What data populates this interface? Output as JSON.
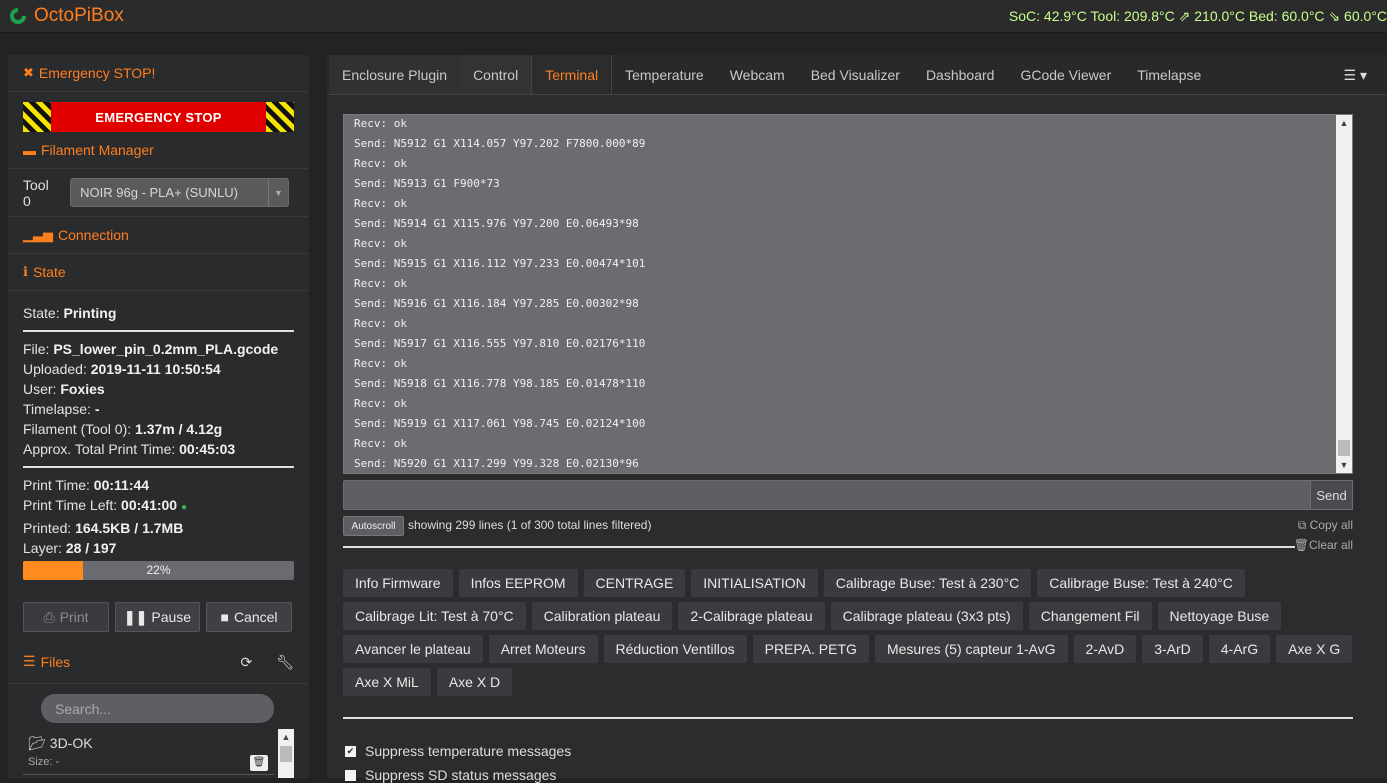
{
  "app": {
    "name": "OctoPiBox",
    "accent": "#ff7f1f"
  },
  "status_bar": {
    "text": "SoC: 42.9°C Tool: 209.8°C ⇗ 210.0°C Bed: 60.0°C ⇘ 60.0°C"
  },
  "sidebar": {
    "emergency_title": "Emergency STOP!",
    "emergency_button": "EMERGENCY STOP",
    "filament_title": "Filament Manager",
    "tool_label": "Tool 0",
    "tool_selected": "NOIR 96g - PLA+ (SUNLU)",
    "connection_title": "Connection",
    "state_title": "State",
    "state": {
      "state_label": "State:",
      "state_value": "Printing",
      "file_label": "File:",
      "file_value": "PS_lower_pin_0.2mm_PLA.gcode",
      "uploaded_label": "Uploaded:",
      "uploaded_value": "2019-11-11 10:50:54",
      "user_label": "User:",
      "user_value": "Foxies",
      "timelapse_label": "Timelapse:",
      "timelapse_value": "-",
      "filament_label": "Filament (Tool 0):",
      "filament_value": "1.37m / 4.12g",
      "approx_label": "Approx. Total Print Time:",
      "approx_value": "00:45:03",
      "print_time_label": "Print Time:",
      "print_time_value": "00:11:44",
      "time_left_label": "Print Time Left:",
      "time_left_value": "00:41:00",
      "printed_label": "Printed:",
      "printed_value": "164.5KB / 1.7MB",
      "layer_label": "Layer:",
      "layer_value": "28 / 197",
      "progress_text": "22%",
      "progress_fraction": 0.22
    },
    "buttons": {
      "print": "Print",
      "pause": "Pause",
      "cancel": "Cancel"
    },
    "files_title": "Files",
    "search_placeholder": "Search...",
    "files": [
      {
        "name": "3D-OK",
        "size": "Size: -"
      }
    ]
  },
  "tabs": [
    "Enclosure Plugin",
    "Control",
    "Terminal",
    "Temperature",
    "Webcam",
    "Bed Visualizer",
    "Dashboard",
    "GCode Viewer",
    "Timelapse"
  ],
  "terminal": {
    "lines": [
      "Recv: ok",
      "Send: N5912 G1 X114.057 Y97.202 F7800.000*89",
      "Recv: ok",
      "Send: N5913 G1 F900*73",
      "Recv: ok",
      "Send: N5914 G1 X115.976 Y97.200 E0.06493*98",
      "Recv: ok",
      "Send: N5915 G1 X116.112 Y97.233 E0.00474*101",
      "Recv: ok",
      "Send: N5916 G1 X116.184 Y97.285 E0.00302*98",
      "Recv: ok",
      "Send: N5917 G1 X116.555 Y97.810 E0.02176*110",
      "Recv: ok",
      "Send: N5918 G1 X116.778 Y98.185 E0.01478*110",
      "Recv: ok",
      "Send: N5919 G1 X117.061 Y98.745 E0.02124*100",
      "Recv: ok",
      "Send: N5920 G1 X117.299 Y99.328 E0.02130*96"
    ],
    "send_label": "Send",
    "autoscroll_label": "Autoscroll",
    "lines_info": "showing 299 lines (1 of 300 total lines filtered)",
    "copy_all": "Copy all",
    "clear_all": "Clear all"
  },
  "macros": [
    "Info Firmware",
    "Infos EEPROM",
    "CENTRAGE",
    "INITIALISATION",
    "Calibrage Buse: Test à 230°C",
    "Calibrage Buse: Test à 240°C",
    "Calibrage Lit: Test à 70°C",
    "Calibration plateau",
    "2-Calibrage plateau",
    "Calibrage plateau (3x3 pts)",
    "Changement Fil",
    "Nettoyage Buse",
    "Avancer le plateau",
    "Arret Moteurs",
    "Réduction Ventillos",
    "PREPA. PETG",
    "Mesures (5) capteur 1-AvG",
    "2-AvD",
    "3-ArD",
    "4-ArG",
    "Axe X G",
    "Axe X MiL",
    "Axe X D"
  ],
  "options": {
    "suppress_temp": "Suppress temperature messages",
    "suppress_sd": "Suppress SD status messages"
  }
}
